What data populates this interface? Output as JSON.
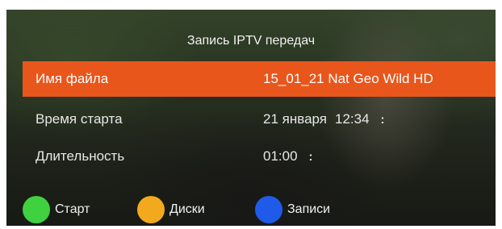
{
  "header": {
    "title": "Запись IPTV передач"
  },
  "rows": [
    {
      "label": "Имя файла",
      "value": "15_01_21 Nat Geo Wild HD",
      "selected": true
    },
    {
      "label": "Время старта",
      "date": "21 января",
      "time": "12:34",
      "spinner": ":"
    },
    {
      "label": "Длительность",
      "value": "01:00",
      "spinner": ":"
    }
  ],
  "footer": {
    "buttons": [
      {
        "label": "Старт",
        "color": "#3fd13f",
        "icon": "green-dot-icon"
      },
      {
        "label": "Диски",
        "color": "#f2a91e",
        "icon": "yellow-dot-icon"
      },
      {
        "label": "Записи",
        "color": "#1f5ae8",
        "icon": "blue-dot-icon"
      }
    ]
  },
  "colors": {
    "selection": "#e8561c"
  }
}
